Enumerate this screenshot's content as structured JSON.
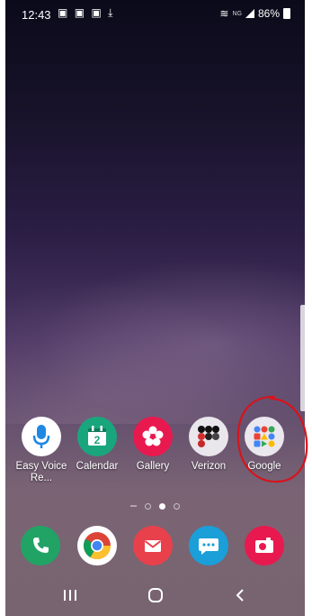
{
  "status_bar": {
    "time": "12:43",
    "battery": "86%",
    "network": "NG"
  },
  "home_apps": [
    {
      "label": "Easy Voice Re...",
      "icon": "microphone-icon",
      "bg": "#ffffff",
      "fg": "#1e88e5"
    },
    {
      "label": "Calendar",
      "icon": "calendar-icon",
      "bg": "#1aa67d",
      "fg": "#ffffff",
      "date": "2"
    },
    {
      "label": "Gallery",
      "icon": "flower-icon",
      "bg": "#e8194f",
      "fg": "#ffffff"
    },
    {
      "label": "Verizon",
      "icon": "folder-icon",
      "bg": "#e9e6ec",
      "fg": "#111111"
    },
    {
      "label": "Google",
      "icon": "folder-icon",
      "bg": "#ebe7ee",
      "fg": "#333333"
    }
  ],
  "dock": [
    {
      "name": "phone",
      "icon": "phone-icon",
      "bg": "#21a366"
    },
    {
      "name": "chrome",
      "icon": "chrome-icon",
      "bg": "#ffffff"
    },
    {
      "name": "email",
      "icon": "email-icon",
      "bg": "#e8414b"
    },
    {
      "name": "messages",
      "icon": "chat-bubble-icon",
      "bg": "#1a9fd8"
    },
    {
      "name": "camera",
      "icon": "camera-icon",
      "bg": "#e8194f"
    }
  ],
  "page_indicator": {
    "pages": 3,
    "active": 2
  },
  "annotation_color": "#d7131c"
}
